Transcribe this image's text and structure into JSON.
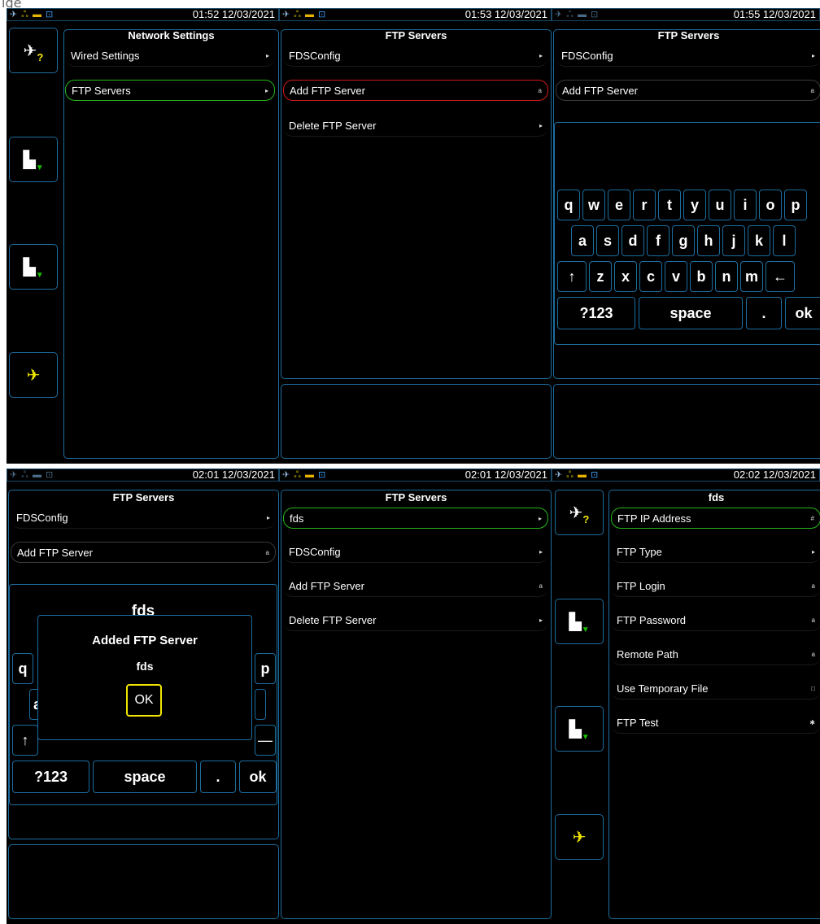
{
  "caption": "ige",
  "screens": [
    {
      "clock": "01:52 12/03/2021",
      "title": "Network Settings",
      "rows": [
        {
          "label": "Wired Settings",
          "indicator": "▸"
        },
        {
          "label": "FTP Servers",
          "indicator": "▸"
        }
      ]
    },
    {
      "clock": "01:53 12/03/2021",
      "title": "FTP Servers",
      "rows": [
        {
          "label": "FDSConfig",
          "indicator": "▸"
        },
        {
          "label": "Add FTP Server",
          "indicator": "a"
        },
        {
          "label": "Delete FTP Server",
          "indicator": "▸"
        }
      ]
    },
    {
      "clock": "01:55 12/03/2021",
      "title": "FTP Servers",
      "rows": [
        {
          "label": "FDSConfig",
          "indicator": "▸"
        },
        {
          "label": "Add FTP Server",
          "indicator": "a"
        }
      ],
      "keyboard": {
        "row1": [
          "q",
          "w",
          "e",
          "r",
          "t",
          "y",
          "u",
          "i",
          "o",
          "p"
        ],
        "row2": [
          "a",
          "s",
          "d",
          "f",
          "g",
          "h",
          "j",
          "k",
          "l"
        ],
        "row3": [
          "↑",
          "z",
          "x",
          "c",
          "v",
          "b",
          "n",
          "m",
          "←"
        ],
        "row4": [
          "?123",
          "space",
          ".",
          "ok"
        ]
      }
    },
    {
      "clock": "02:01 12/03/2021",
      "title": "FTP Servers",
      "rows": [
        {
          "label": "FDSConfig",
          "indicator": "▸"
        },
        {
          "label": "Add FTP Server",
          "indicator": "a"
        }
      ],
      "input_value": "fds",
      "dialog": {
        "title": "Added FTP Server",
        "name": "fds",
        "ok": "OK"
      },
      "keyboard": {
        "visible_left": [
          "q",
          "a",
          "↑"
        ],
        "visible_right": [
          "p",
          "—"
        ],
        "row4": [
          "?123",
          "space",
          ".",
          "ok"
        ]
      }
    },
    {
      "clock": "02:01 12/03/2021",
      "title": "FTP Servers",
      "rows": [
        {
          "label": "fds",
          "indicator": "▸"
        },
        {
          "label": "FDSConfig",
          "indicator": "▸"
        },
        {
          "label": "Add FTP Server",
          "indicator": "a"
        },
        {
          "label": "Delete FTP Server",
          "indicator": "▸"
        }
      ]
    },
    {
      "clock": "02:02 12/03/2021",
      "title": "fds",
      "rows": [
        {
          "label": "FTP IP Address",
          "indicator": "#"
        },
        {
          "label": "FTP Type",
          "indicator": "▸"
        },
        {
          "label": "FTP Login",
          "indicator": "a"
        },
        {
          "label": "FTP Password",
          "indicator": "a"
        },
        {
          "label": "Remote Path",
          "indicator": "a"
        },
        {
          "label": "Use Temporary File",
          "indicator": "□"
        },
        {
          "label": "FTP Test",
          "indicator": "✱"
        }
      ]
    }
  ],
  "icons": {
    "plane_question": "airplane-question-icon",
    "save_down": "floppy-save-icon",
    "plane": "airplane-icon"
  }
}
